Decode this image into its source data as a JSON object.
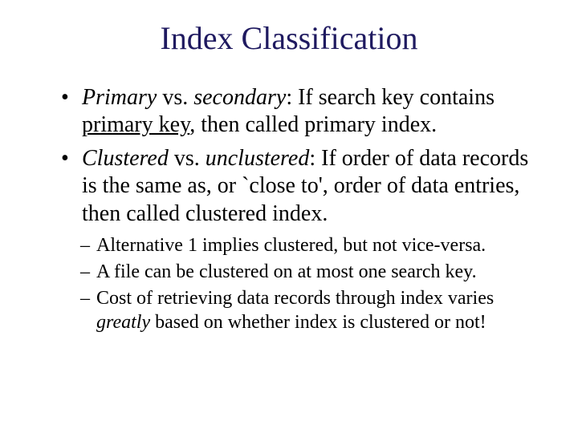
{
  "title": "Index Classification",
  "b1": {
    "term1": "Primary",
    "vs": " vs. ",
    "term2": "secondary",
    "colon_sp": ":  ",
    "rest1": "If search key contains ",
    "pk": "primary key",
    "rest2": ", then called primary index."
  },
  "b2": {
    "term1": "Clustered",
    "vs": " vs. ",
    "term2": "unclustered",
    "colon_sp": ":  ",
    "rest": "If order of data records is the same as, or `close to', order of data entries, then called clustered index."
  },
  "s1": "Alternative 1 implies clustered, but not vice-versa.",
  "s2": "A file can be clustered on at most one search key.",
  "s3": {
    "a": "Cost of retrieving data records through index varies ",
    "g": "greatly",
    "b": " based on whether index is clustered or not!"
  }
}
